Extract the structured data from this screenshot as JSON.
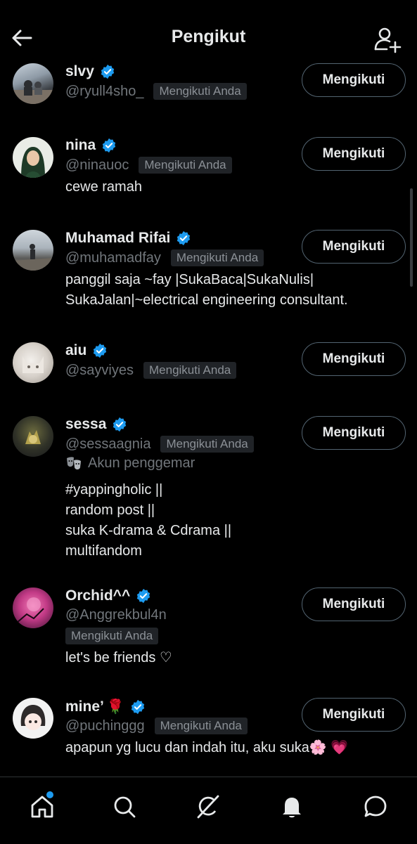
{
  "header": {
    "title": "Pengikut"
  },
  "follow_tag": "Mengikuti Anda",
  "button_label": "Mengikuti",
  "users": [
    {
      "name": "slvy",
      "handle": "@ryull4sho_",
      "bio": []
    },
    {
      "name": "nina",
      "handle": "@ninauoc",
      "bio": [
        "cewe ramah"
      ]
    },
    {
      "name": "Muhamad Rifai",
      "handle": "@muhamadfay",
      "bio": [
        "panggil saja ~fay |SukaBaca|SukaNulis|",
        "SukaJalan|~electrical engineering consultant."
      ]
    },
    {
      "name": "aiu",
      "handle": "@sayviyes",
      "bio": []
    },
    {
      "name": "sessa",
      "handle": "@sessaagnia",
      "fan_label": "Akun penggemar",
      "bio": [
        "#yappingholic ||",
        "random post ||",
        "suka K-drama & Cdrama ||",
        "multifandom"
      ]
    },
    {
      "name": "Orchid^^",
      "handle": "@Anggrekbul4n",
      "bio": [
        "let's be friends ♡"
      ]
    },
    {
      "name": "mine’",
      "name_emoji": "🌹",
      "handle": "@puchinggg",
      "bio": [
        "apapun yg lucu dan indah itu, aku suka🌸 💗"
      ]
    }
  ],
  "nav": [
    "home-icon",
    "search-icon",
    "grok-icon",
    "notifications-icon",
    "messages-icon"
  ],
  "colors": {
    "verified": "#1d9bf0",
    "background": "#000000",
    "muted": "#71767b"
  }
}
